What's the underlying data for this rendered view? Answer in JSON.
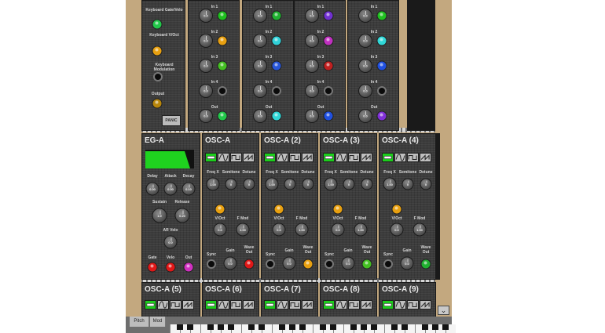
{
  "colors": {
    "rack_wood": "#c3a87f",
    "panel": "#3c3c3c",
    "label": "#d8d8d8",
    "wave_active": "#1ccd1c",
    "envelope": "#1fd21f"
  },
  "keyboard_module": {
    "gate_label": "Keyboard Gate/Velo",
    "voct_label": "Keyboard V/Oct",
    "mod_label": "Keyboard Modulation",
    "output_label": "Output",
    "panic_label": "PANIC"
  },
  "mixers": [
    {
      "labels": [
        "In 1",
        "In 2",
        "In 3",
        "In 4",
        "Out"
      ],
      "knobs": [
        "0.0",
        "0.0",
        "0.0",
        "0.0",
        "0.0"
      ],
      "plugs": [
        "#1ec01e",
        "#e8a010",
        "#44c022",
        "",
        "#22c84a"
      ]
    },
    {
      "labels": [
        "In 1",
        "In 2",
        "In 3",
        "In 4",
        "Out"
      ],
      "knobs": [
        "0.0",
        "0.0",
        "0.0",
        "0.0",
        "0.0"
      ],
      "plugs": [
        "#20b030",
        "#30d0d8",
        "#2856d8",
        "",
        "#30d8d8"
      ]
    },
    {
      "labels": [
        "In 1",
        "In 2",
        "In 3",
        "In 4",
        "Out"
      ],
      "knobs": [
        "0.0",
        "0.0",
        "0.0",
        "0.0",
        "0.0"
      ],
      "plugs": [
        "#7030d0",
        "#c030c0",
        "#c02020",
        "",
        "#2050e0"
      ]
    },
    {
      "labels": [
        "In 1",
        "In 2",
        "In 3",
        "In 4",
        "Out"
      ],
      "knobs": [
        "0.0",
        "0.0",
        "0.0",
        "0.0",
        "0.0"
      ],
      "plugs": [
        "#20c020",
        "#30d8d8",
        "#2050e0",
        "",
        "#8030d8"
      ]
    }
  ],
  "eg": {
    "title": "EG-A",
    "delay_label": "Delay",
    "attack_label": "Attack",
    "decay_label": "Decay",
    "delay_value": "0.00",
    "attack_value": "0.00",
    "decay_value": "0.10",
    "sustain_label": "Sustain",
    "release_label": "Release",
    "sustain_value": "1.0",
    "release_value": "0.20",
    "ar_velo_label": "AR Velo",
    "ar_velo_value": "0.0",
    "gate_label": "Gate",
    "velo_label": "Velo",
    "out_label": "Out"
  },
  "oscillators_top": [
    {
      "title": "OSC-A",
      "freq_label": "Freq X",
      "semitone_label": "Semitone",
      "detune_label": "Detune",
      "freq_value": "1.00",
      "semitone_value": "0",
      "detune_value": "0",
      "voct_label": "V/Oct",
      "fmod_label": "F Mod",
      "fmod_value": "0.0",
      "fmod_amt": "1.00",
      "sync_label": "Sync",
      "gain_label": "Gain",
      "wave_out_label": "Wave Out",
      "gain_value": "0.0",
      "plug": "#e01818"
    },
    {
      "title": "OSC-A (2)",
      "freq_label": "Freq X",
      "semitone_label": "Semitone",
      "detune_label": "Detune",
      "freq_value": "1.00",
      "semitone_value": "0",
      "detune_value": "0",
      "voct_label": "V/Oct",
      "fmod_label": "F Mod",
      "fmod_value": "0.0",
      "fmod_amt": "1.00",
      "sync_label": "Sync",
      "gain_label": "Gain",
      "wave_out_label": "Wave Out",
      "gain_value": "0.0",
      "plug": "#e8a010"
    },
    {
      "title": "OSC-A (3)",
      "freq_label": "Freq X",
      "semitone_label": "Semitone",
      "detune_label": "Detune",
      "freq_value": "1.00",
      "semitone_value": "0",
      "detune_value": "0",
      "voct_label": "V/Oct",
      "fmod_label": "F Mod",
      "fmod_value": "0.0",
      "fmod_amt": "1.00",
      "sync_label": "Sync",
      "gain_label": "Gain",
      "wave_out_label": "Wave Out",
      "gain_value": "0.0",
      "plug": "#44c022"
    },
    {
      "title": "OSC-A (4)",
      "freq_label": "Freq X",
      "semitone_label": "Semitone",
      "detune_label": "Detune",
      "freq_value": "1.00",
      "semitone_value": "0",
      "detune_value": "0",
      "voct_label": "V/Oct",
      "fmod_label": "F Mod",
      "fmod_value": "0.0",
      "fmod_amt": "1.00",
      "sync_label": "Sync",
      "gain_label": "Gain",
      "wave_out_label": "Wave Out",
      "gain_value": "0.0",
      "plug": "#20b030"
    }
  ],
  "oscillators_bottom": [
    {
      "title": "OSC-A (5)"
    },
    {
      "title": "OSC-A (6)"
    },
    {
      "title": "OSC-A (7)"
    },
    {
      "title": "OSC-A (8)"
    },
    {
      "title": "OSC-A (9)"
    }
  ],
  "keyboard_bar": {
    "pitch_label": "Pitch",
    "mod_label": "Mod"
  },
  "scroll_glyph": "⌄"
}
